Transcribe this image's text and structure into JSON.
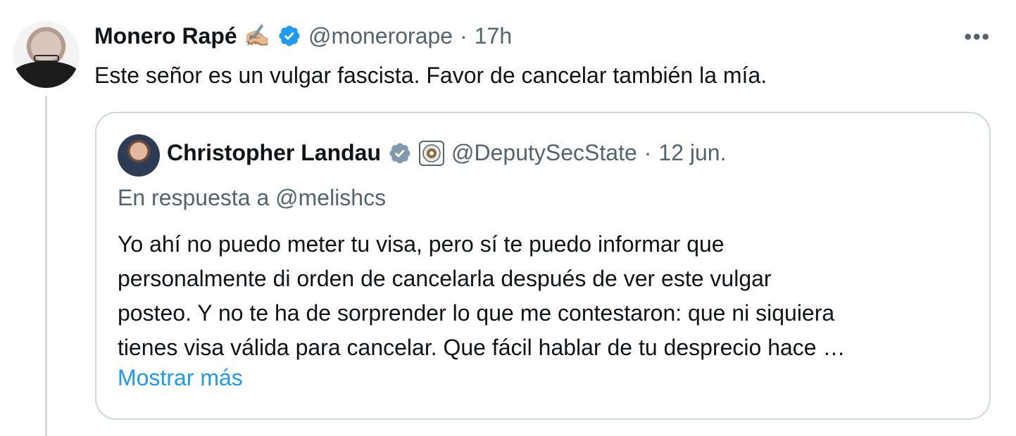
{
  "tweet": {
    "author_name": "Monero Rapé",
    "author_emoji": "✍🏼",
    "handle": "@monerorape",
    "separator": "·",
    "time": "17h",
    "more_icon": "more-horizontal-icon",
    "text": "Este señor es un vulgar fascista. Favor de cancelar también la mía."
  },
  "quote": {
    "author_name": "Christopher Landau",
    "handle": "@DeputySecState",
    "separator": "·",
    "date": "12 jun.",
    "replying_to": "En respuesta a @melishcs",
    "body_lines": [
      "Yo ahí no puedo meter tu visa, pero sí te puedo informar que",
      "personalmente di orden de cancelarla después de ver este vulgar",
      "posteo. Y no te ha de sorprender lo que me contestaron: que ni siquiera",
      "tienes visa válida para cancelar. Que fácil hablar de tu desprecio hace …"
    ],
    "show_more": "Mostrar más"
  },
  "colors": {
    "verified_blue": "#1d9bf0",
    "verified_gray": "#829aab",
    "secondary_text": "#536471",
    "border": "#cfd9de"
  }
}
